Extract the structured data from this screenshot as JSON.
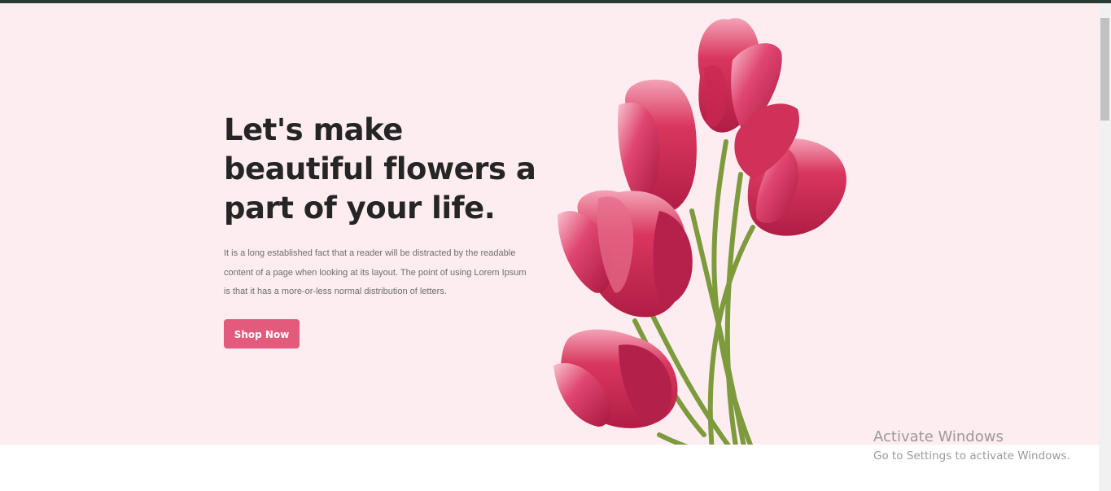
{
  "hero": {
    "title_line1": "Let's make",
    "title_line2": "beautiful flowers a",
    "title_line3": "part of your life.",
    "description": "It is a long established fact that a reader will be distracted by the readable content of a page when looking at its layout. The point of using Lorem Ipsum is that it has a more-or-less normal distribution of letters.",
    "button_label": "Shop Now"
  },
  "watermark": {
    "title": "Activate Windows",
    "subtitle": "Go to Settings to activate Windows."
  },
  "colors": {
    "hero_background": "#fdedf0",
    "button": "#e35a7d",
    "heading": "#252525",
    "top_bar": "#2b3a34"
  },
  "icons": {
    "illustration": "tulip-bouquet-image"
  }
}
